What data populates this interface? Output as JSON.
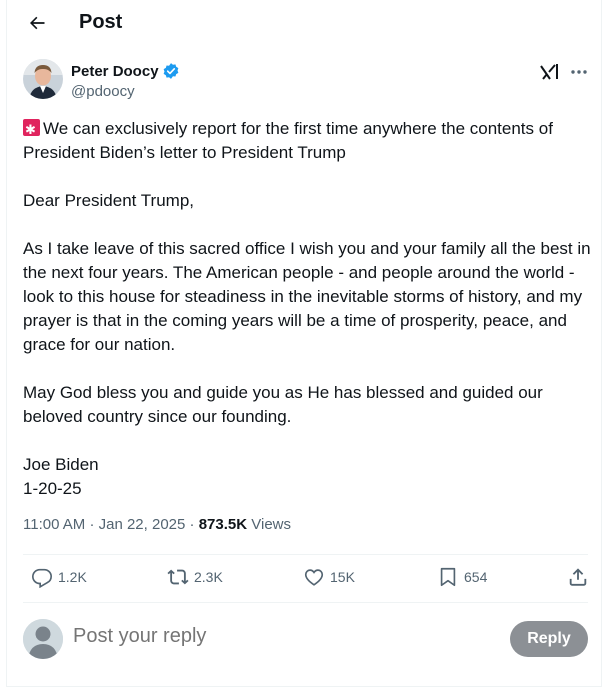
{
  "header": {
    "title": "Post"
  },
  "author": {
    "name": "Peter Doocy",
    "handle": "@pdoocy"
  },
  "post": {
    "paragraphs": [
      "We can exclusively report for the first time anywhere the contents of President Biden’s letter to President Trump",
      "Dear President Trump,",
      "As I take leave of this sacred office I wish you and your family all the best in the next four years.  The American people - and people around the world - look to this house for steadiness in the inevitable storms of history, and my prayer is that in the coming years will be a time of prosperity, peace, and grace for our nation.",
      "May God bless you and guide you as He has blessed and guided our beloved country since our founding.",
      "Joe Biden",
      "1-20-25"
    ],
    "time": "11:00 AM",
    "separator": "·",
    "date": "Jan 22, 2025",
    "views_count": "873.5K",
    "views_label": "Views"
  },
  "actions": {
    "replies": "1.2K",
    "reposts": "2.3K",
    "likes": "15K",
    "bookmarks": "654"
  },
  "reply": {
    "placeholder": "Post your reply",
    "button_label": "Reply"
  },
  "colors": {
    "verified": "#1d9bf0",
    "muted": "#536471",
    "reply_button": "#8c9095",
    "siren": "#e0245e"
  },
  "icons": [
    "back-arrow-icon",
    "verified-badge-icon",
    "grok-icon",
    "more-icon",
    "siren-emoji-icon",
    "reply-icon",
    "repost-icon",
    "like-icon",
    "bookmark-icon",
    "share-icon"
  ]
}
